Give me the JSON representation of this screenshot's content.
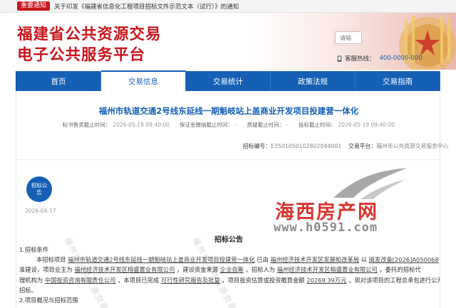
{
  "notice": {
    "tag": "重要通知",
    "text": "关于印发《福建省信息化工程项目招标文件示范文本（试行）》的通知"
  },
  "header": {
    "title_line1": "福建省公共资源交易",
    "title_line2": "电子公共服务平台",
    "search_placeholder": "请输",
    "hotline_label": "客服热线：",
    "hotline_number": "400-0000-000"
  },
  "nav": {
    "items": [
      {
        "label": "首页",
        "active": false
      },
      {
        "label": "交易信息",
        "active": true
      },
      {
        "label": "交易统计",
        "active": false
      },
      {
        "label": "政策法规",
        "active": false
      },
      {
        "label": "交易指南",
        "active": false
      }
    ]
  },
  "project": {
    "title": "福州市轨道交通2号线东延线一期魁岐站上盖商业开发项目投建营一体化",
    "meta": [
      {
        "label": "标书售卖截止时间：",
        "value": "2026-05-19 09:40:00"
      },
      {
        "label": "保证金缴纳截止时间：",
        "value": "-"
      },
      {
        "label": "质疑截止时间：",
        "value": "-"
      },
      {
        "label": "投标截止时间：",
        "value": "2026-05-19 09:40:00"
      }
    ],
    "code_label": "招标编号：",
    "code_value": "E3501050102802044001",
    "platform_label": "交易平台：",
    "platform_value": "福州市公共资源交易服务中心"
  },
  "announcement": {
    "badge": "招标公告",
    "date": "2026-04-17",
    "section_title": "招标公告",
    "heading1": "1.招标条件",
    "para_line1_pre": "本招标项目",
    "para_line1_proj": "福州市轨道交通2号线东延线一期魁岐站上盖商业开发项目投建营一体化",
    "para_line1_mid": "已由",
    "para_line1_org": "福州经济技术开发区发展和改革局",
    "para_line1_post": "以",
    "para_line1_doc": "闽发改备[2026]A050068",
    "para_line1_end": "批",
    "para_line2_a": "准建设，项目业主为",
    "para_line2_b": "福州经济技术开发区榕盛置业有限公司",
    "para_line2_c": "，建设资金来源",
    "para_line2_d": "企业自筹",
    "para_line2_e": "，招标人为",
    "para_line2_f": "福州经济技术开发区榕盛置业有限公司",
    "para_line2_g": "，委托的招标代",
    "para_line3_a": "理机构为",
    "para_line3_b": "中国投资咨询有限责任公司",
    "para_line3_c": "，本项目已完成",
    "para_line3_d": "可行性研究报告及批复",
    "para_line3_e": "，项目投资估算或投资概算金额",
    "para_line3_f": "20269.39万元",
    "para_line3_g": "，现对该项目的工程总承包进行公开",
    "para_line4": "招标。",
    "heading2": "2.项目概况与招标范围"
  },
  "watermark": {
    "title": "海西房产网",
    "url": "www.h0591.com",
    "diag": "福州市公共资源交易"
  },
  "colors": {
    "brand_red": "#c8161d",
    "nav_blue": "#1560b5"
  }
}
